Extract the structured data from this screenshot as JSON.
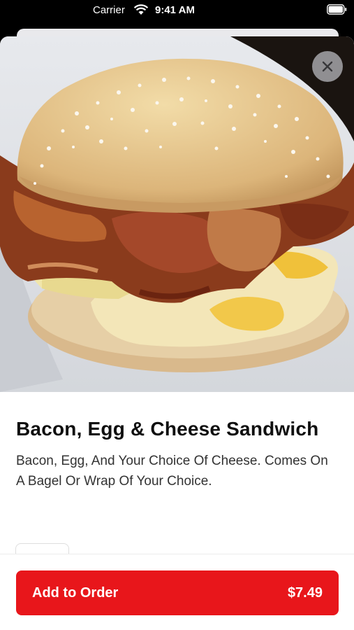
{
  "status_bar": {
    "carrier": "Carrier",
    "time": "9:41 AM"
  },
  "hero": {
    "icon": "bacon-egg-cheese-sandwich-image"
  },
  "close": {
    "icon": "close-icon"
  },
  "item": {
    "title": "Bacon, Egg & Cheese Sandwich",
    "description": "Bacon, Egg, And Your Choice Of Cheese. Comes On A Bagel Or Wrap Of Your Choice."
  },
  "order": {
    "button_label": "Add to Order",
    "price": "$7.49",
    "accent_color": "#e8161b"
  }
}
